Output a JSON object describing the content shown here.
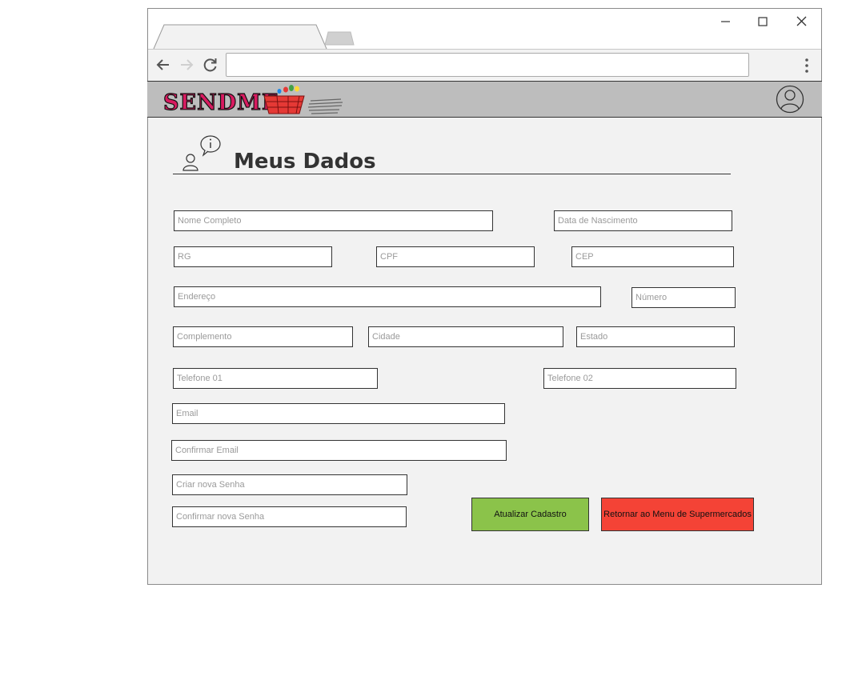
{
  "browser": {
    "url": "",
    "colors": {
      "chrome": "#f2f2f2",
      "appbar": "#bdbdbd"
    }
  },
  "app": {
    "logo_text": "SENDME",
    "title": "Meus Dados"
  },
  "form": {
    "nome_completo": {
      "placeholder": "Nome Completo",
      "value": ""
    },
    "data_nascimento": {
      "placeholder": "Data de Nascimento",
      "value": ""
    },
    "rg": {
      "placeholder": "RG",
      "value": ""
    },
    "cpf": {
      "placeholder": "CPF",
      "value": ""
    },
    "cep": {
      "placeholder": "CEP",
      "value": ""
    },
    "endereco": {
      "placeholder": "Endereço",
      "value": ""
    },
    "numero": {
      "placeholder": "Número",
      "value": ""
    },
    "complemento": {
      "placeholder": "Complemento",
      "value": ""
    },
    "cidade": {
      "placeholder": "Cidade",
      "value": ""
    },
    "estado": {
      "placeholder": "Estado",
      "value": ""
    },
    "telefone_01": {
      "placeholder": "Telefone 01",
      "value": ""
    },
    "telefone_02": {
      "placeholder": "Telefone 02",
      "value": ""
    },
    "email": {
      "placeholder": "Email",
      "value": ""
    },
    "confirmar_email": {
      "placeholder": "Confirmar Email",
      "value": ""
    },
    "nova_senha": {
      "placeholder": "Criar nova Senha",
      "value": ""
    },
    "confirmar_senha": {
      "placeholder": "Confirmar nova Senha",
      "value": ""
    }
  },
  "actions": {
    "update_label": "Atualizar Cadastro",
    "update_color": "#8bc34a",
    "return_label": "Retornar ao Menu de Supermercados",
    "return_color": "#f44336"
  },
  "icons": {
    "back": "arrow-left-icon",
    "forward": "arrow-right-icon",
    "reload": "reload-icon",
    "menu": "kebab-menu-icon",
    "user": "user-circle-icon",
    "profile_info": "user-info-icon"
  }
}
